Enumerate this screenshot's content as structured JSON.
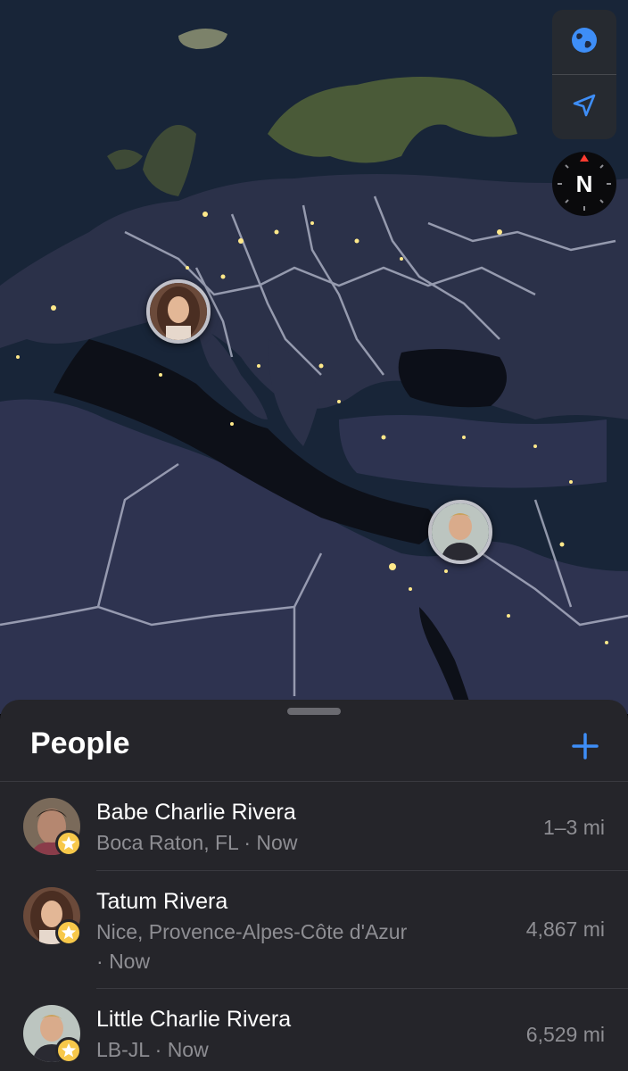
{
  "map": {
    "controls": [
      {
        "name": "globe-icon"
      },
      {
        "name": "location-arrow-icon"
      }
    ],
    "compass_label": "N",
    "accent": "#3e8ef7"
  },
  "people_sheet": {
    "title": "People",
    "add_icon": "plus-icon",
    "rows": [
      {
        "name": "Babe Charlie Rivera",
        "location": "Boca Raton, FL",
        "time": "Now",
        "distance": "1–3 mi",
        "favorite": true
      },
      {
        "name": "Tatum Rivera",
        "location": "Nice, Provence-Alpes-Côte d'Azur",
        "time": "Now",
        "distance": "4,867 mi",
        "favorite": true
      },
      {
        "name": "Little Charlie Rivera",
        "location": "LB-JL",
        "time": "Now",
        "distance": "6,529 mi",
        "favorite": true
      }
    ]
  }
}
